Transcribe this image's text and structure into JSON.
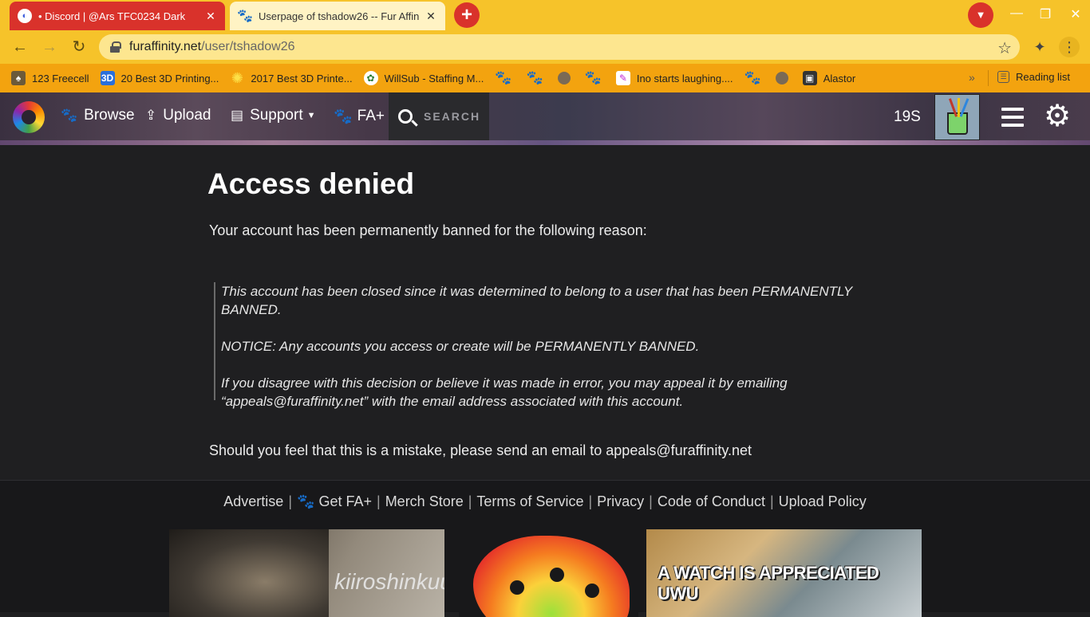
{
  "browser": {
    "tabs": [
      {
        "title": "• Discord | @Ars TFC0234 Dark"
      },
      {
        "title": "Userpage of tshadow26 -- Fur Affinity"
      }
    ],
    "url_host": "furaffinity.net",
    "url_path": "/user/tshadow26",
    "bookmarks": [
      {
        "label": "123 Freecell"
      },
      {
        "label": "20 Best 3D Printing..."
      },
      {
        "label": "2017 Best 3D Printe..."
      },
      {
        "label": "WillSub - Staffing M..."
      },
      {
        "label": "Ino starts laughing...."
      },
      {
        "label": "Alastor"
      }
    ],
    "reading_list": "Reading list",
    "more_bookmarks": "»"
  },
  "header": {
    "nav": [
      {
        "label": "Browse",
        "icon": "paw-icon"
      },
      {
        "label": "Upload",
        "icon": "upload-icon"
      },
      {
        "label": "Support",
        "icon": "support-icon"
      },
      {
        "label": "FA+",
        "icon": "fa-plus-icon"
      }
    ],
    "search_label": "SEARCH",
    "user_count": "19S"
  },
  "main": {
    "title": "Access denied",
    "intro": "Your account has been permanently banned for the following reason:",
    "reason_lines": [
      "This account has been closed since it was determined to belong to a user that has been PERMANENTLY BANNED.",
      "NOTICE: Any accounts you access or create will be PERMANENTLY BANNED.",
      "If you disagree with this decision or believe it was made in error, you may appeal it by emailing “appeals@furaffinity.net” with the email address associated with this account."
    ],
    "mistake": "Should you feel that this is a mistake, please send an email to appeals@furaffinity.net"
  },
  "footer": {
    "links": [
      "Advertise",
      "Get FA+",
      "Merch Store",
      "Terms of Service",
      "Privacy",
      "Code of Conduct",
      "Upload Policy"
    ],
    "ad_left_text": "kiiroshinkuu",
    "ad_right_text": "A WATCH IS APPRECIATED UWU"
  },
  "colors": {
    "chrome_tabstrip": "#f6c32a",
    "bookmarks_bar": "#f3a30f",
    "page_bg": "#1f1f21",
    "footer_bg": "#18181a"
  }
}
